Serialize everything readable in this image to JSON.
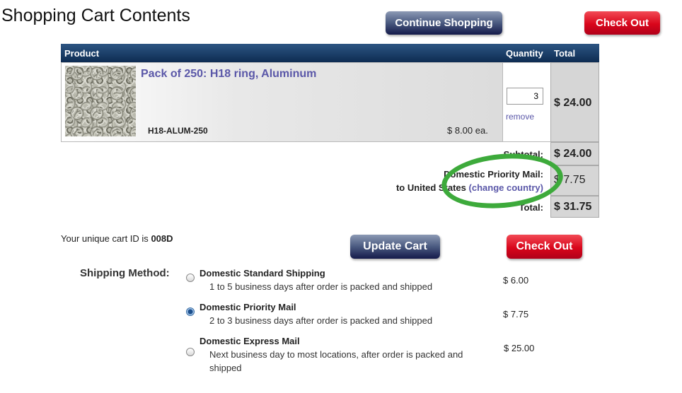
{
  "page_title": "Shopping Cart Contents",
  "buttons": {
    "continue_shopping": "Continue Shopping",
    "check_out_top": "Check Out",
    "update_cart": "Update Cart",
    "check_out_bottom": "Check Out"
  },
  "table": {
    "headers": {
      "product": "Product",
      "quantity": "Quantity",
      "total": "Total"
    },
    "items": [
      {
        "name": "Pack of 250: H18 ring, Aluminum",
        "sku": "H18-ALUM-250",
        "unit_price": "$ 8.00 ea.",
        "quantity": "3",
        "remove_label": "remove",
        "line_total": "$ 24.00"
      }
    ]
  },
  "summary": {
    "subtotal_label": "Subtotal:",
    "subtotal_value": "$ 24.00",
    "shipping_label_line1": "Domestic Priority Mail:",
    "shipping_label_line2_prefix": "to United States",
    "change_country_link": "(change country)",
    "shipping_value": "$ 7.75",
    "total_label": "Total:",
    "total_value": "$ 31.75"
  },
  "cart_id": {
    "prefix": "Your unique cart ID is",
    "value": "008D"
  },
  "shipping_method": {
    "label": "Shipping Method:",
    "options": [
      {
        "title": "Domestic Standard Shipping",
        "desc": "1 to 5 business days after order is packed and shipped",
        "price": "$ 6.00",
        "selected": false
      },
      {
        "title": "Domestic Priority Mail",
        "desc": "2 to 3 business days after order is packed and shipped",
        "price": "$ 7.75",
        "selected": true
      },
      {
        "title": "Domestic Express Mail",
        "desc_line1": "Next business day to most locations, after order is packed and",
        "desc_line2": "shipped",
        "price": "$ 25.00",
        "selected": false
      }
    ]
  },
  "colors": {
    "link": "#5a57a8",
    "annotation_ring": "#3daa3b",
    "header_bar": "#0e2c52",
    "check_out": "#d9061b"
  }
}
